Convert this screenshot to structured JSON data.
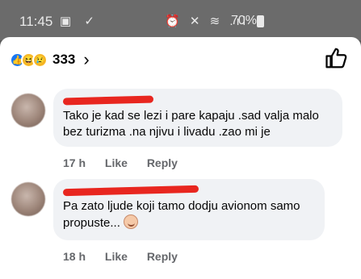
{
  "status_bar": {
    "time": "11:45",
    "left_icons": "▣ ✓",
    "right_icons": "⏰ ✕ ≋ .ıl",
    "battery": "70%"
  },
  "reactions": {
    "count": "333",
    "types": [
      "like-icon",
      "haha-icon",
      "sad-icon"
    ],
    "like_color": "#1877f2",
    "emoji_color": "#f7b928"
  },
  "comments": [
    {
      "text": "Tako je kad se lezi i pare kapaju .sad valja malo bez turizma .na njivu i livadu .zao mi je",
      "time": "17 h",
      "like_label": "Like",
      "reply_label": "Reply"
    },
    {
      "text": "Pa zato ljude koji tamo dodju avionom samo propuste...",
      "time": "18 h",
      "like_label": "Like",
      "reply_label": "Reply"
    }
  ],
  "redaction_color": "#e8261f",
  "meta_color": "#65676b"
}
